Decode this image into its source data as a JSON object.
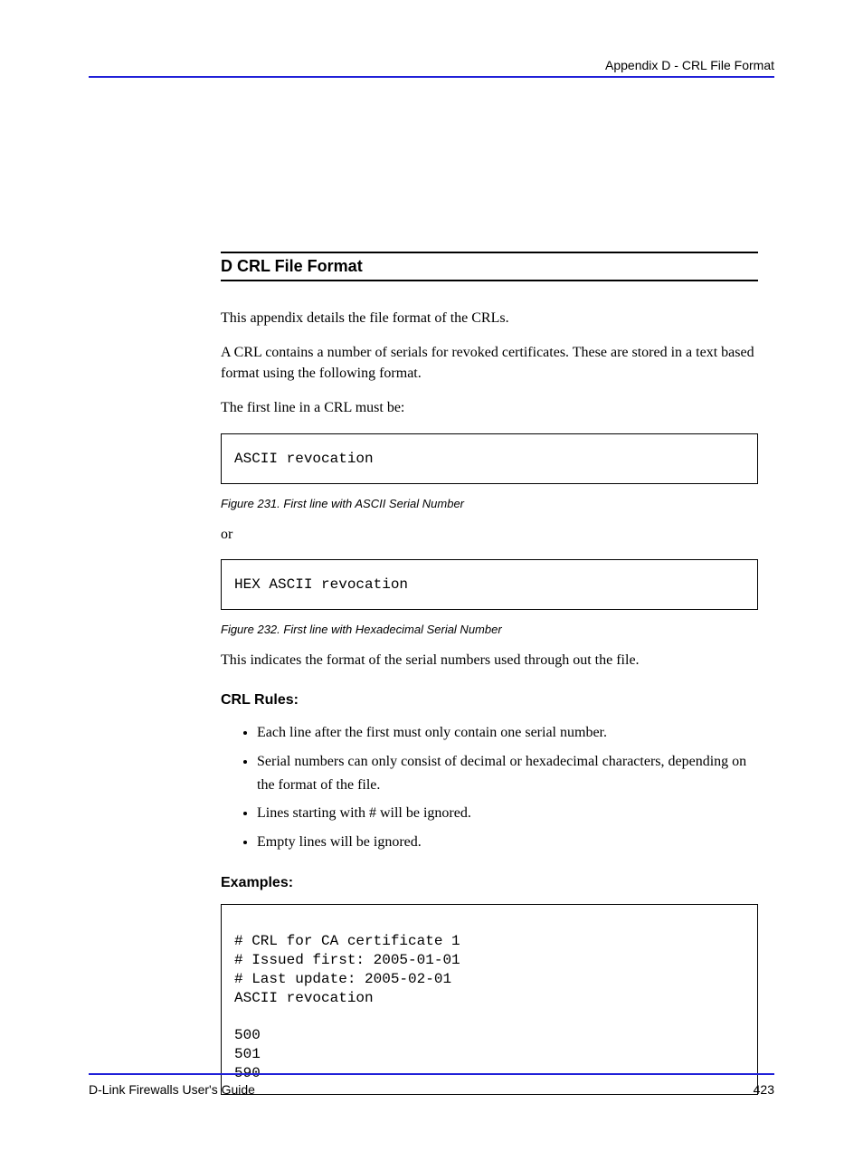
{
  "header": {
    "crumb": "Appendix D - CRL File Format"
  },
  "section": {
    "title": "D CRL File Format",
    "intro1": "This appendix details the file format of the CRLs.",
    "intro2": "A CRL contains a number of serials for revoked certificates. These are stored in a text based format using the following format.",
    "intro3": "The first line in a CRL must be:"
  },
  "box1": {
    "content": "ASCII revocation",
    "caption": "Figure 231. First line with ASCII Serial Number"
  },
  "or_text": "or",
  "box2": {
    "content": "HEX ASCII revocation",
    "caption": "Figure 232. First line with Hexadecimal Serial Number"
  },
  "after_boxes": "This indicates the format of the serial numbers used through out the file.",
  "rules": {
    "heading": "CRL Rules:",
    "items": [
      "Each line after the first must only contain one serial number.",
      "Serial numbers can only consist of decimal or hexadecimal characters, depending on the format of the file.",
      "Lines starting with # will be ignored.",
      "Empty lines will be ignored."
    ]
  },
  "examples_heading": "Examples:",
  "box3": {
    "line1": "# CRL for CA certificate 1",
    "line2": "# Issued first: 2005-01-01",
    "line3": "# Last update: 2005-02-01",
    "line4": "ASCII revocation",
    "line5": "",
    "line6": "500",
    "line7": "501",
    "line8": "590"
  },
  "footer": {
    "left": "D-Link Firewalls User's Guide",
    "right": "423"
  }
}
